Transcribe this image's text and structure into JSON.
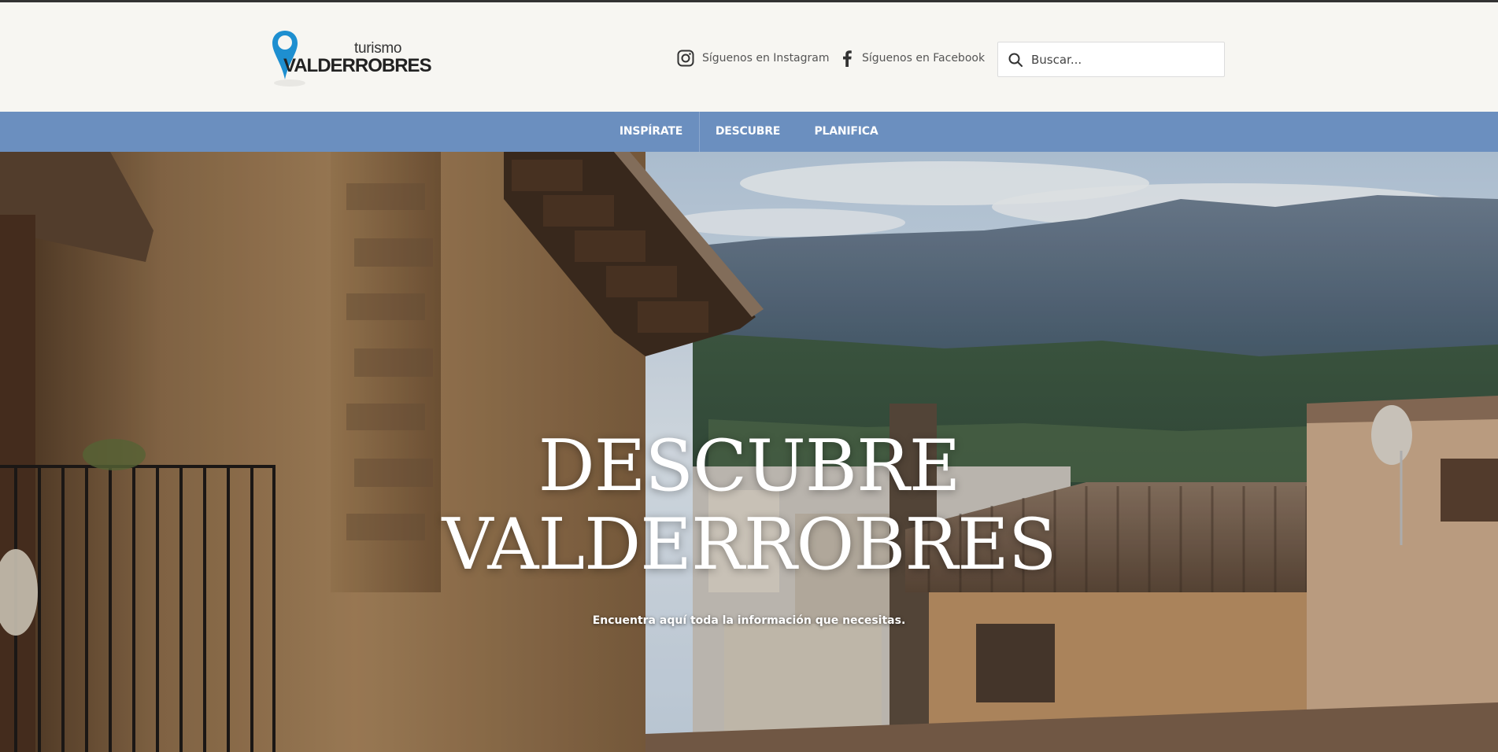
{
  "header": {
    "logo": {
      "small_text": "turismo",
      "big_text": "VALDERROBRES"
    },
    "social": [
      {
        "label": "Síguenos en Instagram",
        "icon": "instagram-icon"
      },
      {
        "label": "Síguenos en Facebook",
        "icon": "facebook-icon"
      }
    ],
    "search": {
      "placeholder": "Buscar...",
      "icon": "search-icon"
    }
  },
  "nav": {
    "items": [
      {
        "label": "INSPÍRATE"
      },
      {
        "label": "DESCUBRE"
      },
      {
        "label": "PLANIFICA"
      }
    ]
  },
  "hero": {
    "title_line1": "DESCUBRE",
    "title_line2": "VALDERROBRES",
    "subtitle": "Encuentra aquí toda la información que necesitas."
  },
  "colors": {
    "nav_bg": "#6b8fbf",
    "header_bg": "#f7f6f2",
    "logo_pin": "#1e8fd0"
  }
}
